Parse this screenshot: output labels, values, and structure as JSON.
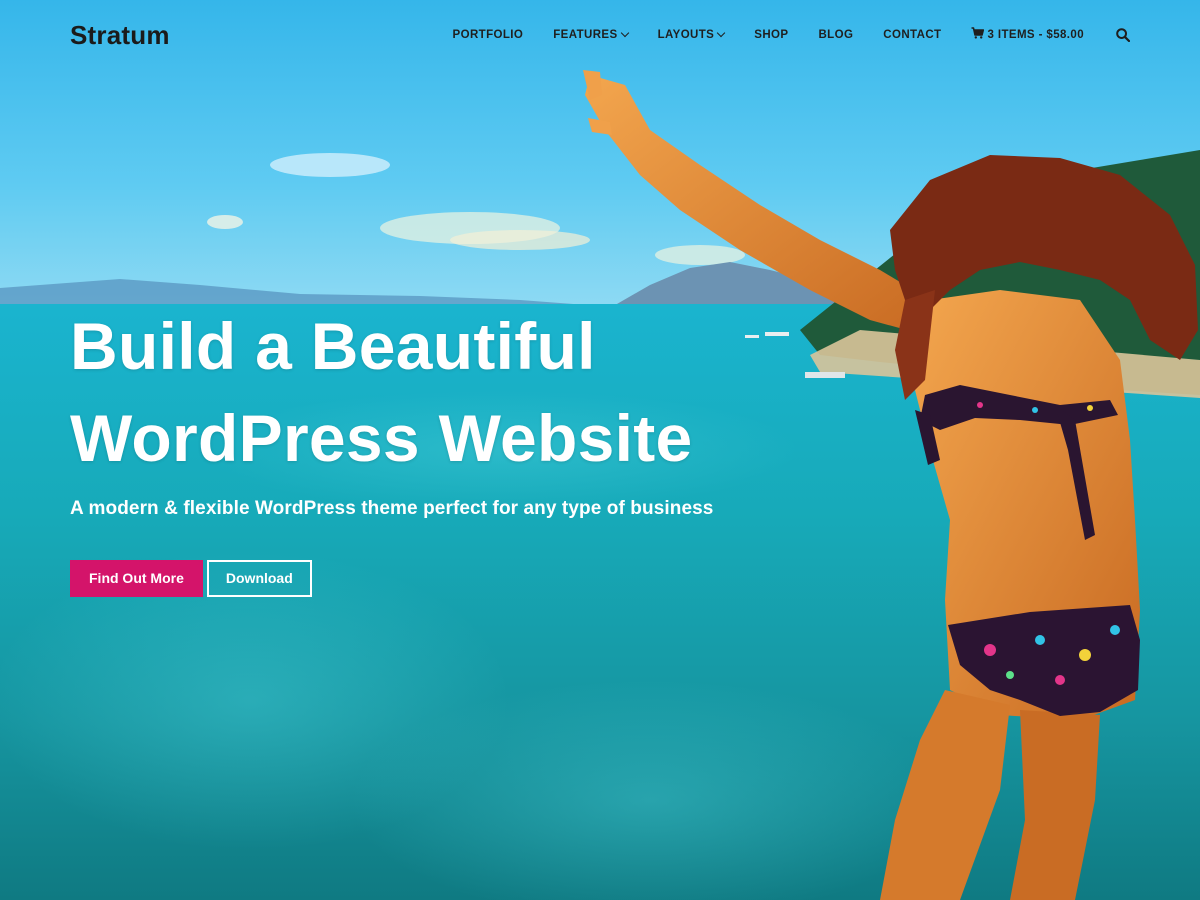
{
  "site": {
    "logo": "Stratum"
  },
  "nav": {
    "items": [
      {
        "label": "PORTFOLIO",
        "dropdown": false
      },
      {
        "label": "FEATURES",
        "dropdown": true
      },
      {
        "label": "LAYOUTS",
        "dropdown": true
      },
      {
        "label": "SHOP",
        "dropdown": false
      },
      {
        "label": "BLOG",
        "dropdown": false
      },
      {
        "label": "CONTACT",
        "dropdown": false
      }
    ],
    "cart": {
      "label": "3 ITEMS - $58.00",
      "icon": "cart-icon"
    },
    "search": {
      "icon": "search-icon"
    }
  },
  "hero": {
    "title_line1": "Build a Beautiful",
    "title_line2": "WordPress Website",
    "subtitle": "A modern & flexible WordPress theme perfect for any type of business",
    "primary_button": "Find Out More",
    "secondary_button": "Download"
  },
  "colors": {
    "accent": "#d4146a",
    "logo": "#1b1b1b",
    "nav_text": "#1f1f1f",
    "hero_text": "#ffffff"
  }
}
